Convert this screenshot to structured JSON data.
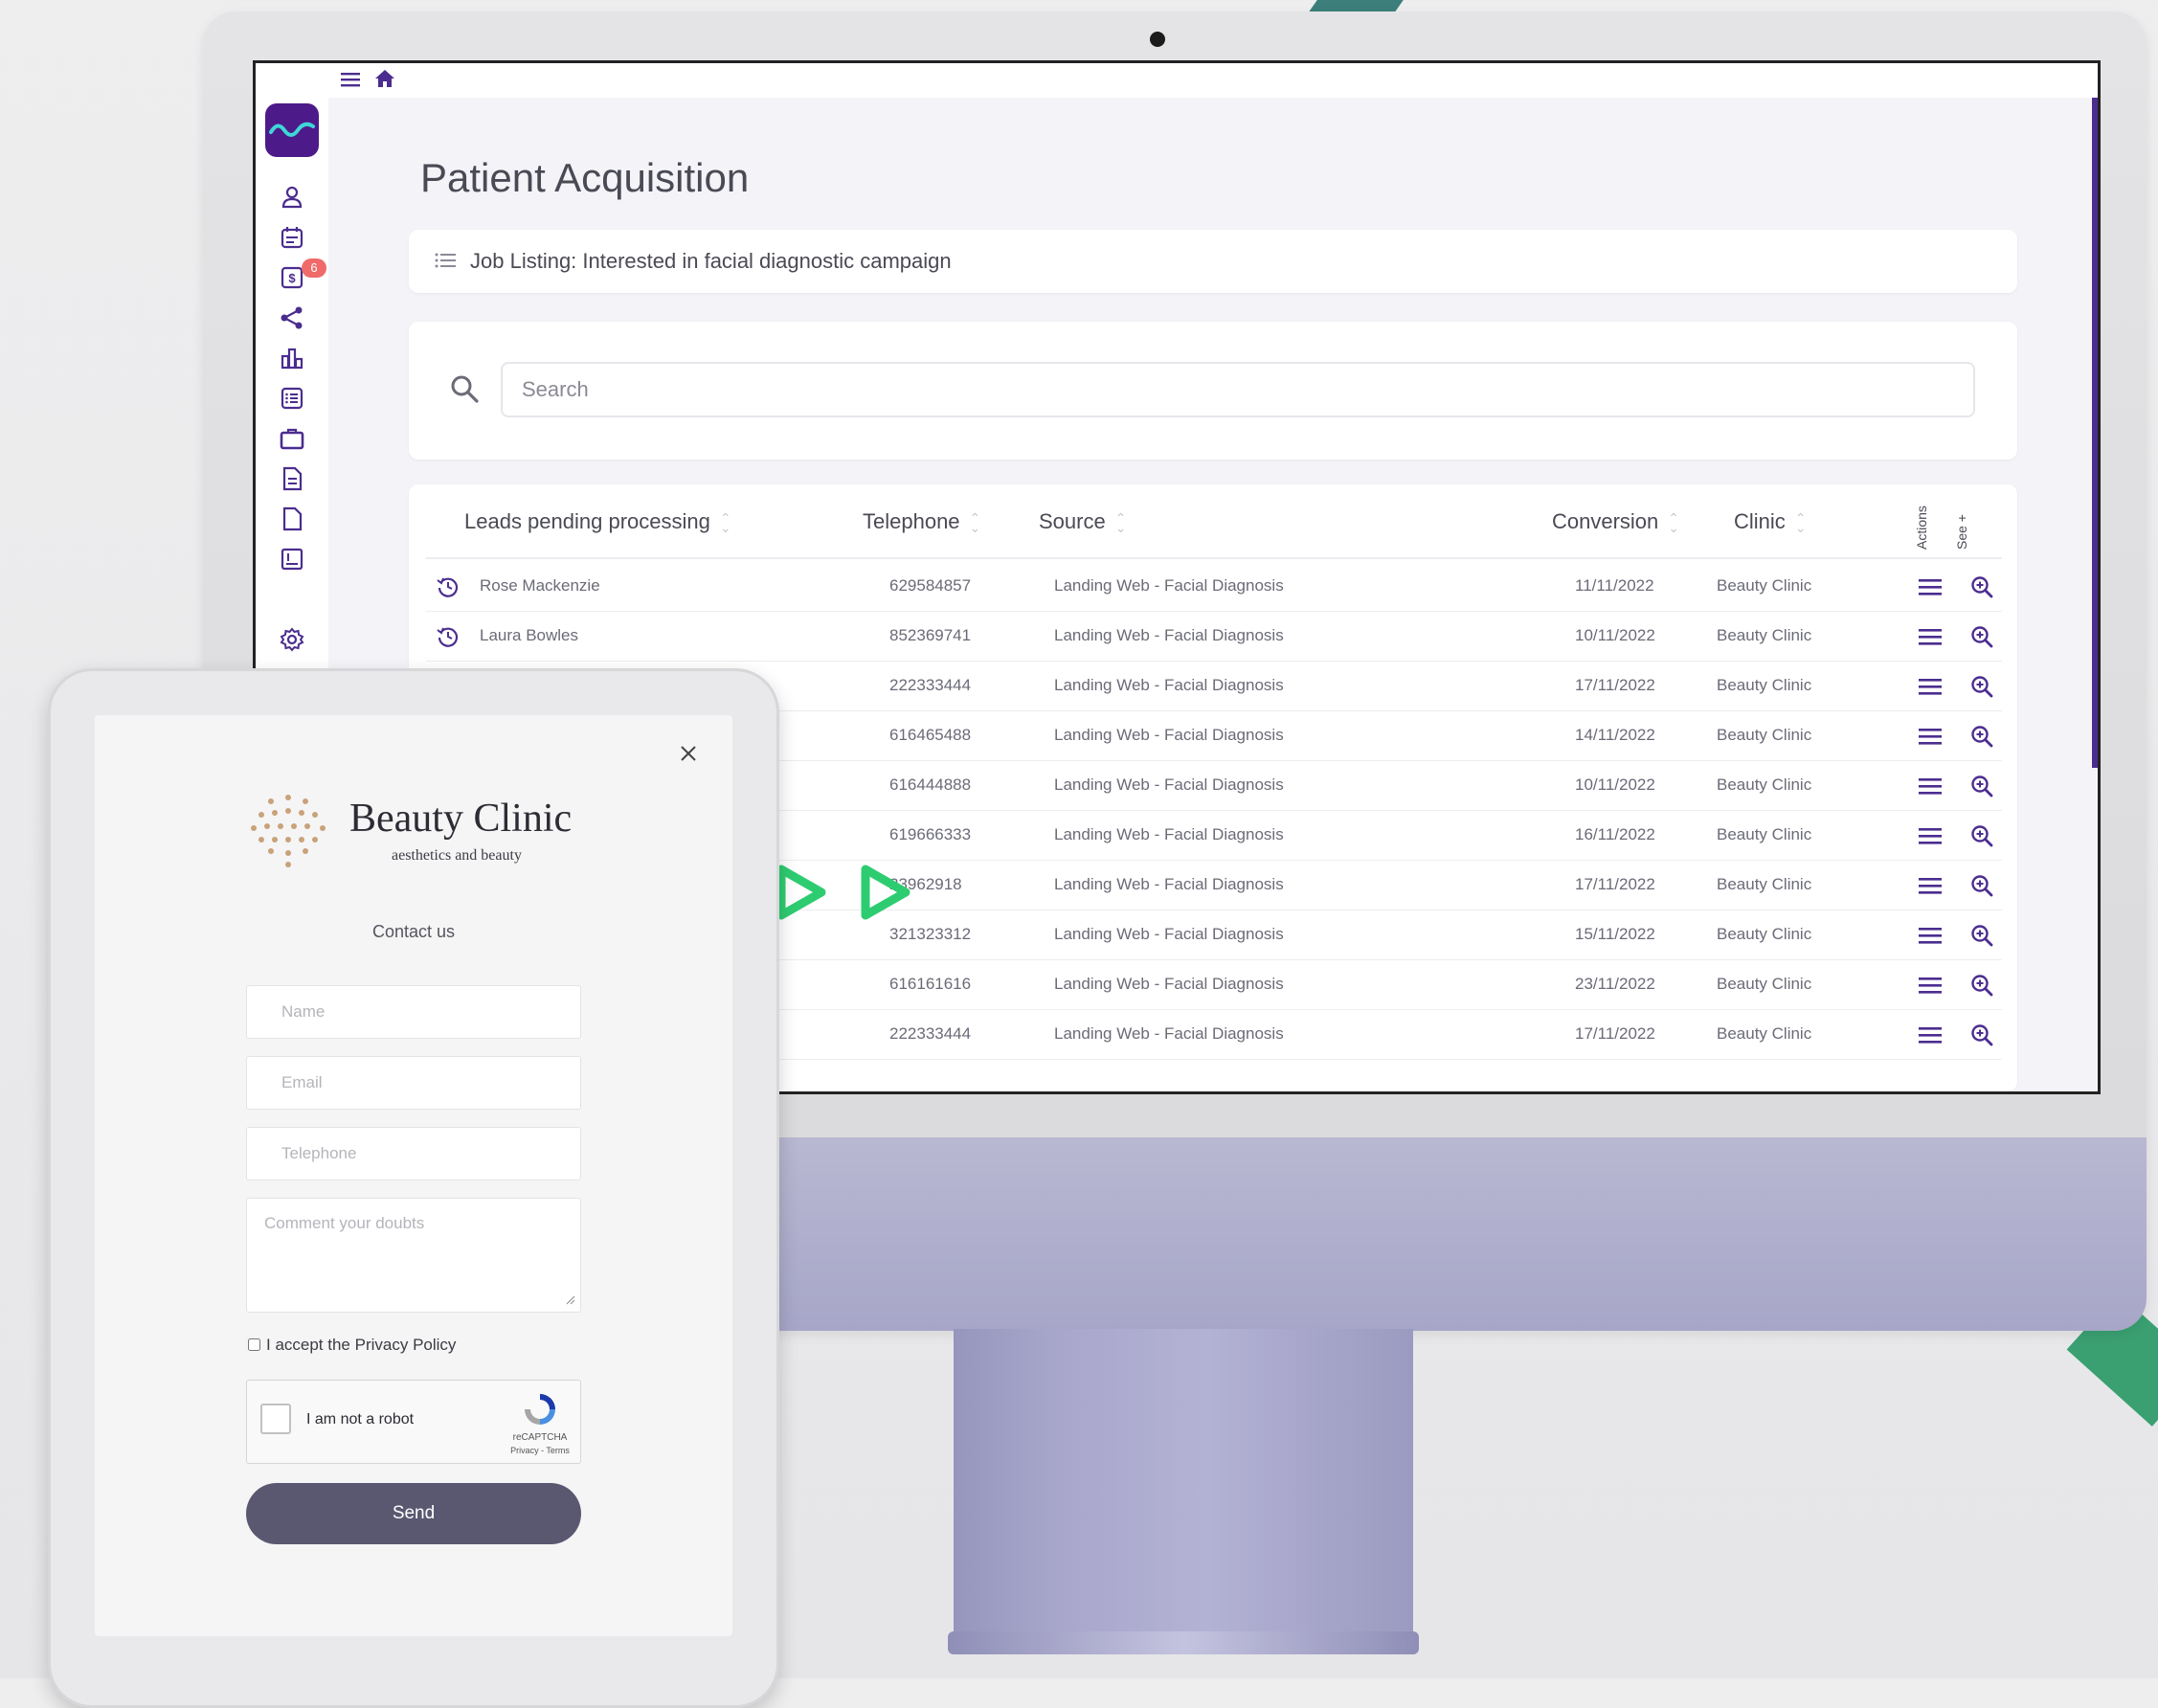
{
  "page": {
    "title": "Patient Acquisition",
    "job_listing": "Job Listing: Interested in facial diagnostic campaign"
  },
  "sidebar": {
    "notification_badge": "6"
  },
  "search": {
    "placeholder": "Search"
  },
  "table": {
    "headers": {
      "leads": "Leads pending processing",
      "telephone": "Telephone",
      "source": "Source",
      "conversion": "Conversion",
      "clinic": "Clinic",
      "actions": "Actions",
      "see": "See +"
    },
    "rows": [
      {
        "name": "Rose Mackenzie",
        "telephone": "629584857",
        "source": "Landing Web - Facial Diagnosis",
        "conversion": "11/11/2022",
        "clinic": "Beauty Clinic"
      },
      {
        "name": "Laura Bowles",
        "telephone": "852369741",
        "source": "Landing Web - Facial Diagnosis",
        "conversion": "10/11/2022",
        "clinic": "Beauty Clinic"
      },
      {
        "name": "",
        "telephone": "222333444",
        "source": "Landing Web - Facial Diagnosis",
        "conversion": "17/11/2022",
        "clinic": "Beauty Clinic"
      },
      {
        "name": "",
        "telephone": "616465488",
        "source": "Landing Web - Facial Diagnosis",
        "conversion": "14/11/2022",
        "clinic": "Beauty Clinic"
      },
      {
        "name": "",
        "telephone": "616444888",
        "source": "Landing Web - Facial Diagnosis",
        "conversion": "10/11/2022",
        "clinic": "Beauty Clinic"
      },
      {
        "name": "",
        "telephone": "619666333",
        "source": "Landing Web - Facial Diagnosis",
        "conversion": "16/11/2022",
        "clinic": "Beauty Clinic"
      },
      {
        "name": "",
        "telephone": "23962918",
        "source": "Landing Web - Facial Diagnosis",
        "conversion": "17/11/2022",
        "clinic": "Beauty Clinic"
      },
      {
        "name": "",
        "telephone": "321323312",
        "source": "Landing Web - Facial Diagnosis",
        "conversion": "15/11/2022",
        "clinic": "Beauty Clinic"
      },
      {
        "name": "",
        "telephone": "616161616",
        "source": "Landing Web - Facial Diagnosis",
        "conversion": "23/11/2022",
        "clinic": "Beauty Clinic"
      },
      {
        "name": "",
        "telephone": "222333444",
        "source": "Landing Web - Facial Diagnosis",
        "conversion": "17/11/2022",
        "clinic": "Beauty Clinic"
      }
    ]
  },
  "form": {
    "brand_name": "Beauty Clinic",
    "brand_tagline": "aesthetics and beauty",
    "contact_title": "Contact us",
    "name_placeholder": "Name",
    "email_placeholder": "Email",
    "telephone_placeholder": "Telephone",
    "comment_placeholder": "Comment your doubts",
    "privacy_label": "I accept the Privacy Policy",
    "captcha_label": "I am not a robot",
    "captcha_brand": "reCAPTCHA",
    "captcha_terms": "Privacy - Terms",
    "send_label": "Send"
  },
  "colors": {
    "accent_purple": "#4d1a8a",
    "arrow_green": "#2ecc71",
    "badge_red": "#f06a6a",
    "send_button": "#5a5870"
  }
}
